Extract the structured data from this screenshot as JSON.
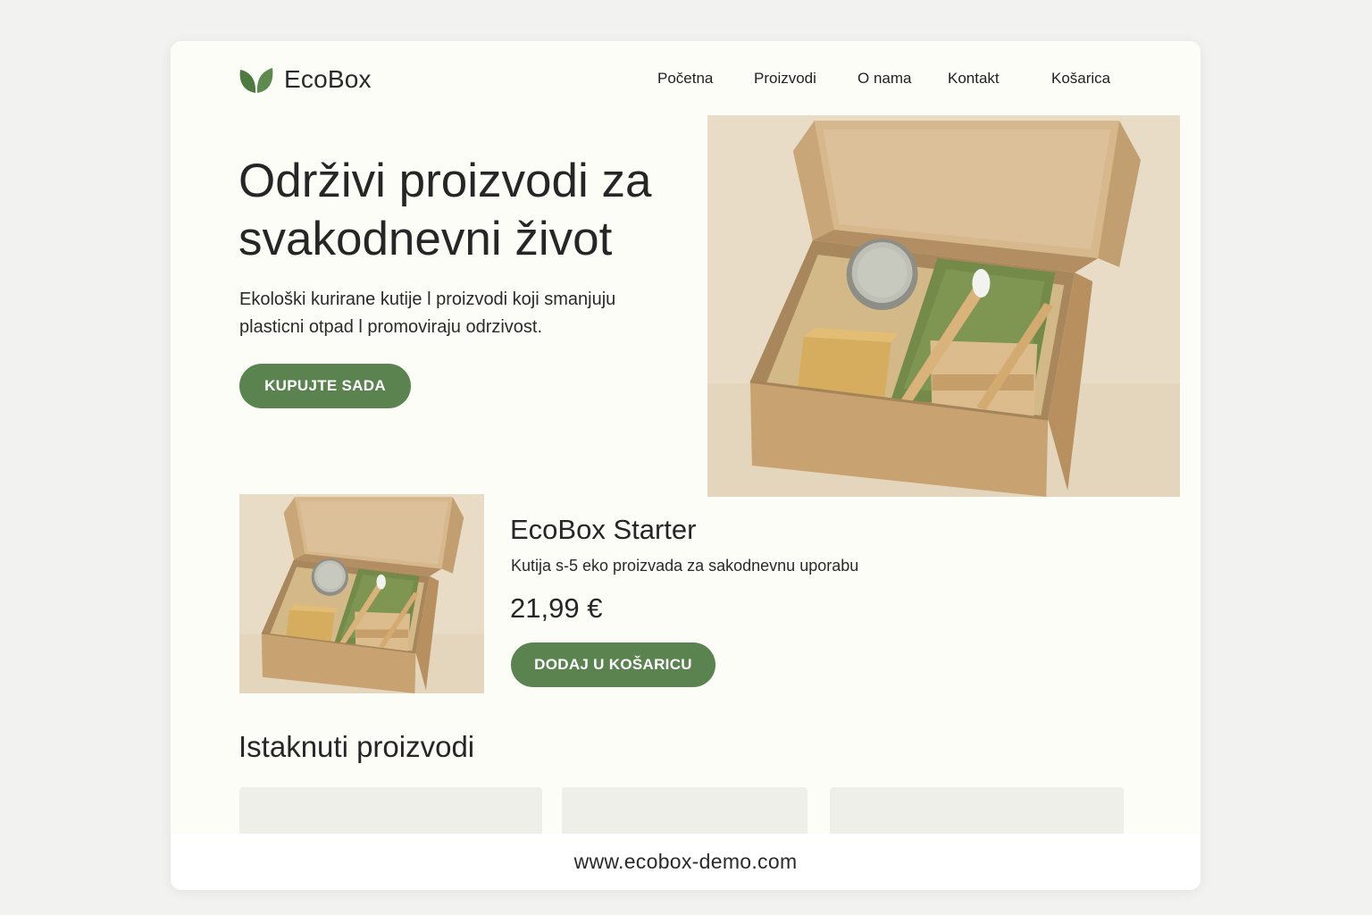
{
  "brand": {
    "name": "EcoBox",
    "logo_icon": "leaf-icon",
    "accent_color": "#5a8350"
  },
  "nav": {
    "items": [
      {
        "label": "Početna"
      },
      {
        "label": "Proizvodi"
      },
      {
        "label": "O nama"
      },
      {
        "label": "Kontakt"
      },
      {
        "label": "Košarica"
      }
    ]
  },
  "hero": {
    "title": "Održivi proizvodi za svakodnevni život",
    "subtitle": "Ekološki kurirane kutije l proizvodi koji smanjuju plasticni otpad l promoviraju odrzivost.",
    "cta_label": "KUPUJTE SADA"
  },
  "product": {
    "name": "EcoBox Starter",
    "description": "Kutija s-5 eko proizvada za sakodnevnu uporabu",
    "price": "21,99 €",
    "cta_label": "DODAJ U KOŠARICU"
  },
  "featured": {
    "title": "Istaknuti proizvodi",
    "cards": [
      {},
      {},
      {}
    ]
  },
  "footer": {
    "url": "www.ecobox-demo.com"
  }
}
